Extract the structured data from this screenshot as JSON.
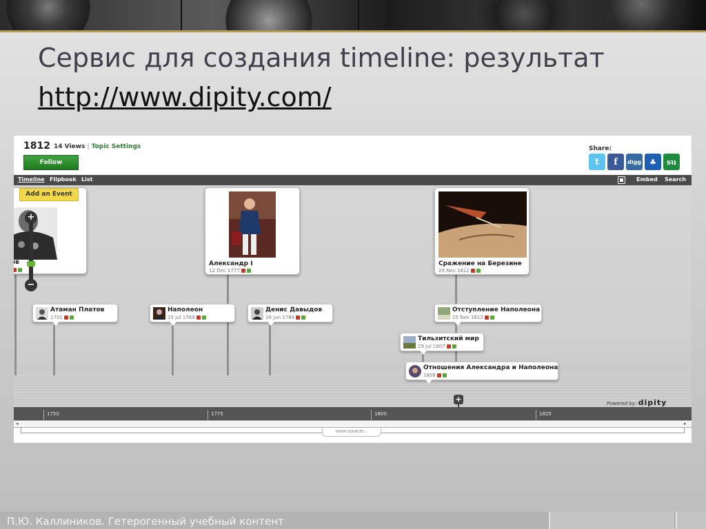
{
  "slide": {
    "title": "Сервис для создания timeline: результат",
    "link": "http://www.dipity.com/",
    "footer": "П.Ю. Каллиников. Гетерогенный учебный контент"
  },
  "dipity": {
    "topic": "1812",
    "views": "14 Views",
    "separator": "|",
    "topic_settings": "Topic Settings",
    "follow": "Follow",
    "share_label": "Share:",
    "share_icons": [
      {
        "name": "twitter-icon",
        "glyph": "t"
      },
      {
        "name": "facebook-icon",
        "glyph": "f"
      },
      {
        "name": "digg-icon",
        "glyph": "digg"
      },
      {
        "name": "myspace-icon",
        "glyph": "♣"
      },
      {
        "name": "stumbleupon-icon",
        "glyph": "su"
      }
    ],
    "tabs": [
      "Timeline",
      "Flipbook",
      "List"
    ],
    "embed": "Embed",
    "search": "Search",
    "add_event": "Add an Event",
    "powered_prefix": "Powered by:",
    "powered_brand": "dipity",
    "show_sources": "SHOW SOURCES ⌄",
    "axis_years": [
      "1750",
      "1775",
      "1800",
      "1825"
    ],
    "big_cards": [
      {
        "caption": "ов",
        "date": ""
      },
      {
        "caption": "Александр I",
        "date": "12 Dec 1777"
      },
      {
        "caption": "Сражение на Березине",
        "date": "29 Nov 1812"
      }
    ],
    "events": [
      {
        "name": "Атаман Платов",
        "date": "1751"
      },
      {
        "name": "Наполеон",
        "date": "15 Jul 1769"
      },
      {
        "name": "Денис Давыдов",
        "date": "16 Jun 1784"
      },
      {
        "name": "Отступление Наполеона",
        "date": "15 Nov 1812"
      },
      {
        "name": "Тильзитский мир",
        "date": "29 Jul 1807"
      },
      {
        "name": "Отношения Александра и Наполеона",
        "date": "1808"
      }
    ],
    "colors": {
      "follow": "#2f8f2f",
      "add_event": "#f0d84a",
      "tabbar": "#4a4a4a",
      "axis": "#545454"
    }
  }
}
